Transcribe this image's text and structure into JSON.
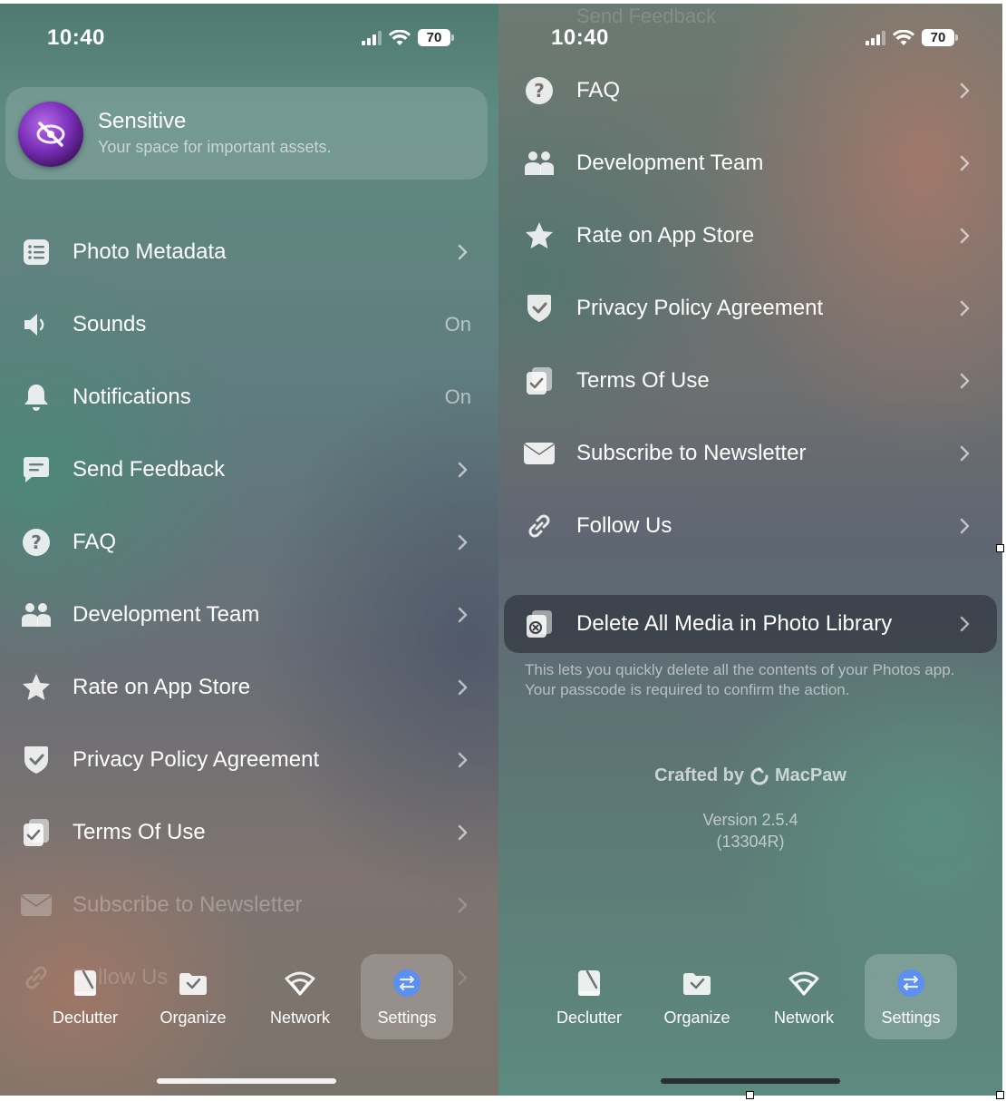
{
  "status": {
    "time": "10:40",
    "battery": "70"
  },
  "sensitive": {
    "title": "Sensitive",
    "subtitle": "Your space for important assets."
  },
  "settings_items": [
    {
      "label": "Photo Metadata",
      "value": "",
      "icon": "list-icon"
    },
    {
      "label": "Sounds",
      "value": "On",
      "icon": "speaker-icon"
    },
    {
      "label": "Notifications",
      "value": "On",
      "icon": "bell-icon"
    },
    {
      "label": "Send Feedback",
      "value": "",
      "icon": "message-icon"
    },
    {
      "label": "FAQ",
      "value": "",
      "icon": "question-icon"
    },
    {
      "label": "Development Team",
      "value": "",
      "icon": "team-icon"
    },
    {
      "label": "Rate on App Store",
      "value": "",
      "icon": "star-icon"
    },
    {
      "label": "Privacy Policy Agreement",
      "value": "",
      "icon": "shield-check-icon"
    },
    {
      "label": "Terms Of Use",
      "value": "",
      "icon": "document-check-icon"
    },
    {
      "label": "Subscribe to Newsletter",
      "value": "",
      "icon": "envelope-icon"
    },
    {
      "label": "Follow Us",
      "value": "",
      "icon": "link-icon"
    }
  ],
  "top_partial_label": "Send Feedback",
  "delete": {
    "label": "Delete All Media in Photo Library",
    "description": "This lets you quickly delete all the contents of your Photos app. Your passcode is required to confirm the action."
  },
  "footer": {
    "crafted_prefix": "Crafted by",
    "brand": "MacPaw",
    "version": "Version 2.5.4",
    "build": "(13304R)"
  },
  "tabs": [
    {
      "label": "Declutter",
      "icon": "declutter-icon",
      "active": false
    },
    {
      "label": "Organize",
      "icon": "organize-icon",
      "active": false
    },
    {
      "label": "Network",
      "icon": "network-icon",
      "active": false
    },
    {
      "label": "Settings",
      "icon": "settings-icon",
      "active": true
    }
  ],
  "colors": {
    "accent_settings": "#5b8ff0",
    "sensitive_purple": "#7a2fb8",
    "home_indicator_light": "#f2f2f2",
    "home_indicator_dark": "#2a2e34"
  }
}
